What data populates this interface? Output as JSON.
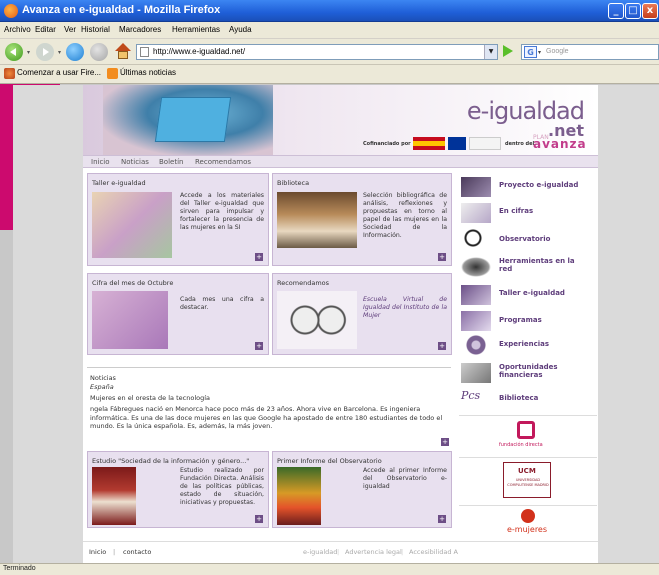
{
  "window": {
    "title": "Avanza en e-igualdad - Mozilla Firefox",
    "buttons": [
      "_",
      "□",
      "x"
    ]
  },
  "menu": [
    "Archivo",
    "Editar",
    "Ver",
    "Historial",
    "Marcadores",
    "Herramientas",
    "Ayuda"
  ],
  "navigation": {
    "url": "http://www.e-igualdad.net/",
    "search_placeholder": "Google",
    "search_engine": "G"
  },
  "bookmarks": [
    "Comenzar a usar Fire...",
    "Últimas noticias"
  ],
  "site": {
    "logo": "e-igualdad",
    "logo_suffix": ".net",
    "cofinanciado": "Cofinanciado por",
    "dentro": "dentro del",
    "plan": "PLAN",
    "avanza": "avanza",
    "topnav": [
      "Inicio",
      "Noticias",
      "Boletín",
      "Recomendamos"
    ],
    "boxes": {
      "taller": {
        "title": "Taller e-igualdad",
        "text": "Accede a los materiales del Taller e-igualdad que sirven para impulsar y fortalecer la presencia de las mujeres en la SI"
      },
      "biblioteca": {
        "title": "Biblioteca",
        "text": "Selección bibliográfica de análisis, reflexiones y propuestas en torno al papel de las mujeres en la Sociedad de la Información."
      },
      "cifra": {
        "title": "Cifra del mes de Octubre",
        "text": "Cada mes una cifra a destacar."
      },
      "recomendamos": {
        "title": "Recomendamos",
        "text": "Escuela Virtual de Igualdad del Instituto de la Mujer"
      },
      "estudio": {
        "title": "Estudio \"Sociedad de la información y género...\"",
        "text": "Estudio realizado por Fundación Directa. Análisis de las políticas públicas, estado de situación, iniciativas y propuestas."
      },
      "informe": {
        "title": "Primer Informe del Observatorio",
        "text": "Accede al primer Informe del Observatorio e-igualdad"
      }
    },
    "notice": {
      "section": "Noticias",
      "region": "España",
      "headline": "Mujeres en el oresta de la tecnología",
      "body": "ngela Fábregues nació en Menorca hace poco más de 23 años. Ahora vive en Barcelona. Es ingeniera informática. Es una de las doce mujeres en las que Google ha apostado de entre 180 estudiantes de todo el mundo. Es la única española. Es, además, la más joven."
    },
    "sidebar": [
      "Proyecto e-igualdad",
      "En cifras",
      "Observatorio",
      "Herramientas en la red",
      "Taller e-igualdad",
      "Programas",
      "Experiencias",
      "Oportunidades financieras",
      "Biblioteca"
    ],
    "partners": [
      "fundación directa",
      "UCM",
      "UNIVERSIDAD COMPLUTENSE MADRID",
      "e-mujeres"
    ],
    "footer_left": [
      "Inicio",
      "contacto"
    ],
    "footer_right": [
      "e-igualdad",
      "Advertencia legal",
      "Accesibilidad A"
    ]
  },
  "status": "Terminado"
}
